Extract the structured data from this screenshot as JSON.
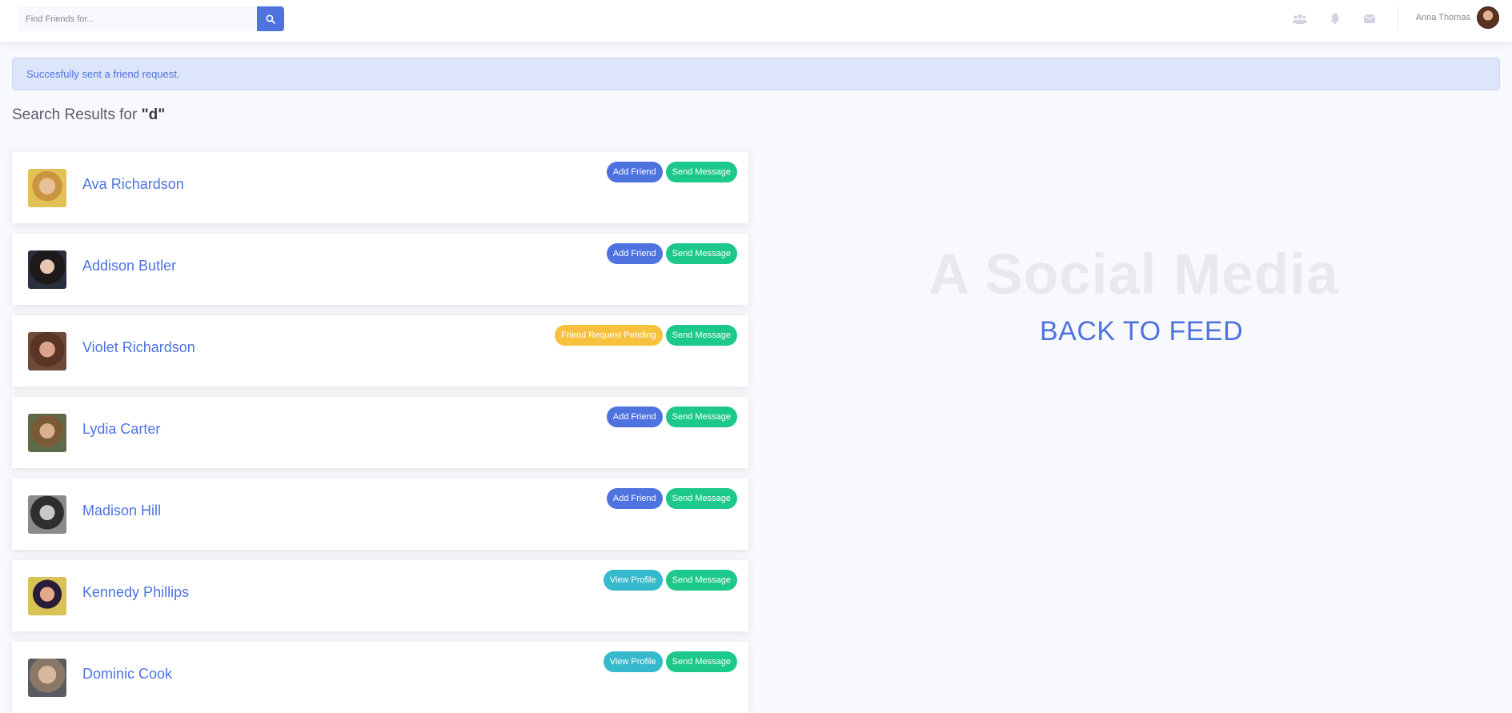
{
  "topbar": {
    "search_placeholder": "Find Friends for...",
    "icons": [
      "users-icon",
      "bell-icon",
      "envelope-icon"
    ],
    "user_name": "Anna Thomas"
  },
  "alert": {
    "message": "Succesfully sent a friend request."
  },
  "results": {
    "prefix": "Search Results for ",
    "query": "\"d\""
  },
  "people": [
    {
      "name": "Ava Richardson",
      "primary_action": "Add Friend",
      "primary_style": "primary",
      "secondary_action": "Send Message"
    },
    {
      "name": "Addison Butler",
      "primary_action": "Add Friend",
      "primary_style": "primary",
      "secondary_action": "Send Message"
    },
    {
      "name": "Violet Richardson",
      "primary_action": "Friend Request Pending",
      "primary_style": "warning",
      "secondary_action": "Send Message"
    },
    {
      "name": "Lydia Carter",
      "primary_action": "Add Friend",
      "primary_style": "primary",
      "secondary_action": "Send Message"
    },
    {
      "name": "Madison Hill",
      "primary_action": "Add Friend",
      "primary_style": "primary",
      "secondary_action": "Send Message"
    },
    {
      "name": "Kennedy Phillips",
      "primary_action": "View Profile",
      "primary_style": "info",
      "secondary_action": "Send Message"
    },
    {
      "name": "Dominic Cook",
      "primary_action": "View Profile",
      "primary_style": "info",
      "secondary_action": "Send Message"
    }
  ],
  "side": {
    "brand": "A Social Media",
    "back_link": "BACK TO FEED"
  },
  "colors": {
    "primary": "#4e73df",
    "success": "#1cc88a",
    "warning": "#f6c23e",
    "info": "#36b9cc",
    "background": "#f8f9fc"
  }
}
